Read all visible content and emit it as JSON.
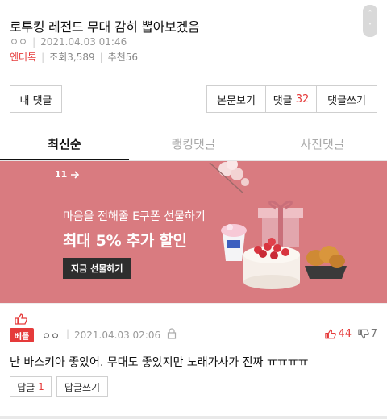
{
  "article": {
    "title": "로투킹 레전드 무대 감히 뽑아보겠음",
    "author": "ㅇㅇ",
    "date": "2021.04.03 01:46",
    "category": "엔터톡",
    "views": "조회3,589",
    "recommends": "추천56"
  },
  "scroll_chip": {
    "up": "˄",
    "down": "˅"
  },
  "buttons": {
    "my_comments": "내 댓글",
    "view_body": "본문보기",
    "comments_label": "댓글",
    "comments_count": "32",
    "write_comment": "댓글쓰기"
  },
  "tabs": [
    {
      "label": "최신순",
      "active": true
    },
    {
      "label": "랭킹댓글",
      "active": false
    },
    {
      "label": "사진댓글",
      "active": false
    }
  ],
  "banner": {
    "logo": "11",
    "subtitle": "마음을 전해줄 E쿠폰 선물하기",
    "title": "최대 5% 추가 할인",
    "cta": "지금 선물하기",
    "bg_color": "#d97b80"
  },
  "comment": {
    "badge": "베플",
    "nickname": "ㅇㅇ",
    "date": "2021.04.03 02:06",
    "likes": "44",
    "dislikes": "7",
    "text": "난 바스키아 좋았어. 무대도 좋았지만 노래가사가 진짜 ㅠㅠㅠㅠ",
    "reply_label": "답글",
    "reply_count": "1",
    "write_reply": "답글쓰기"
  },
  "colors": {
    "accent_red": "#e53a3a",
    "text": "#222222",
    "muted": "#999999"
  }
}
